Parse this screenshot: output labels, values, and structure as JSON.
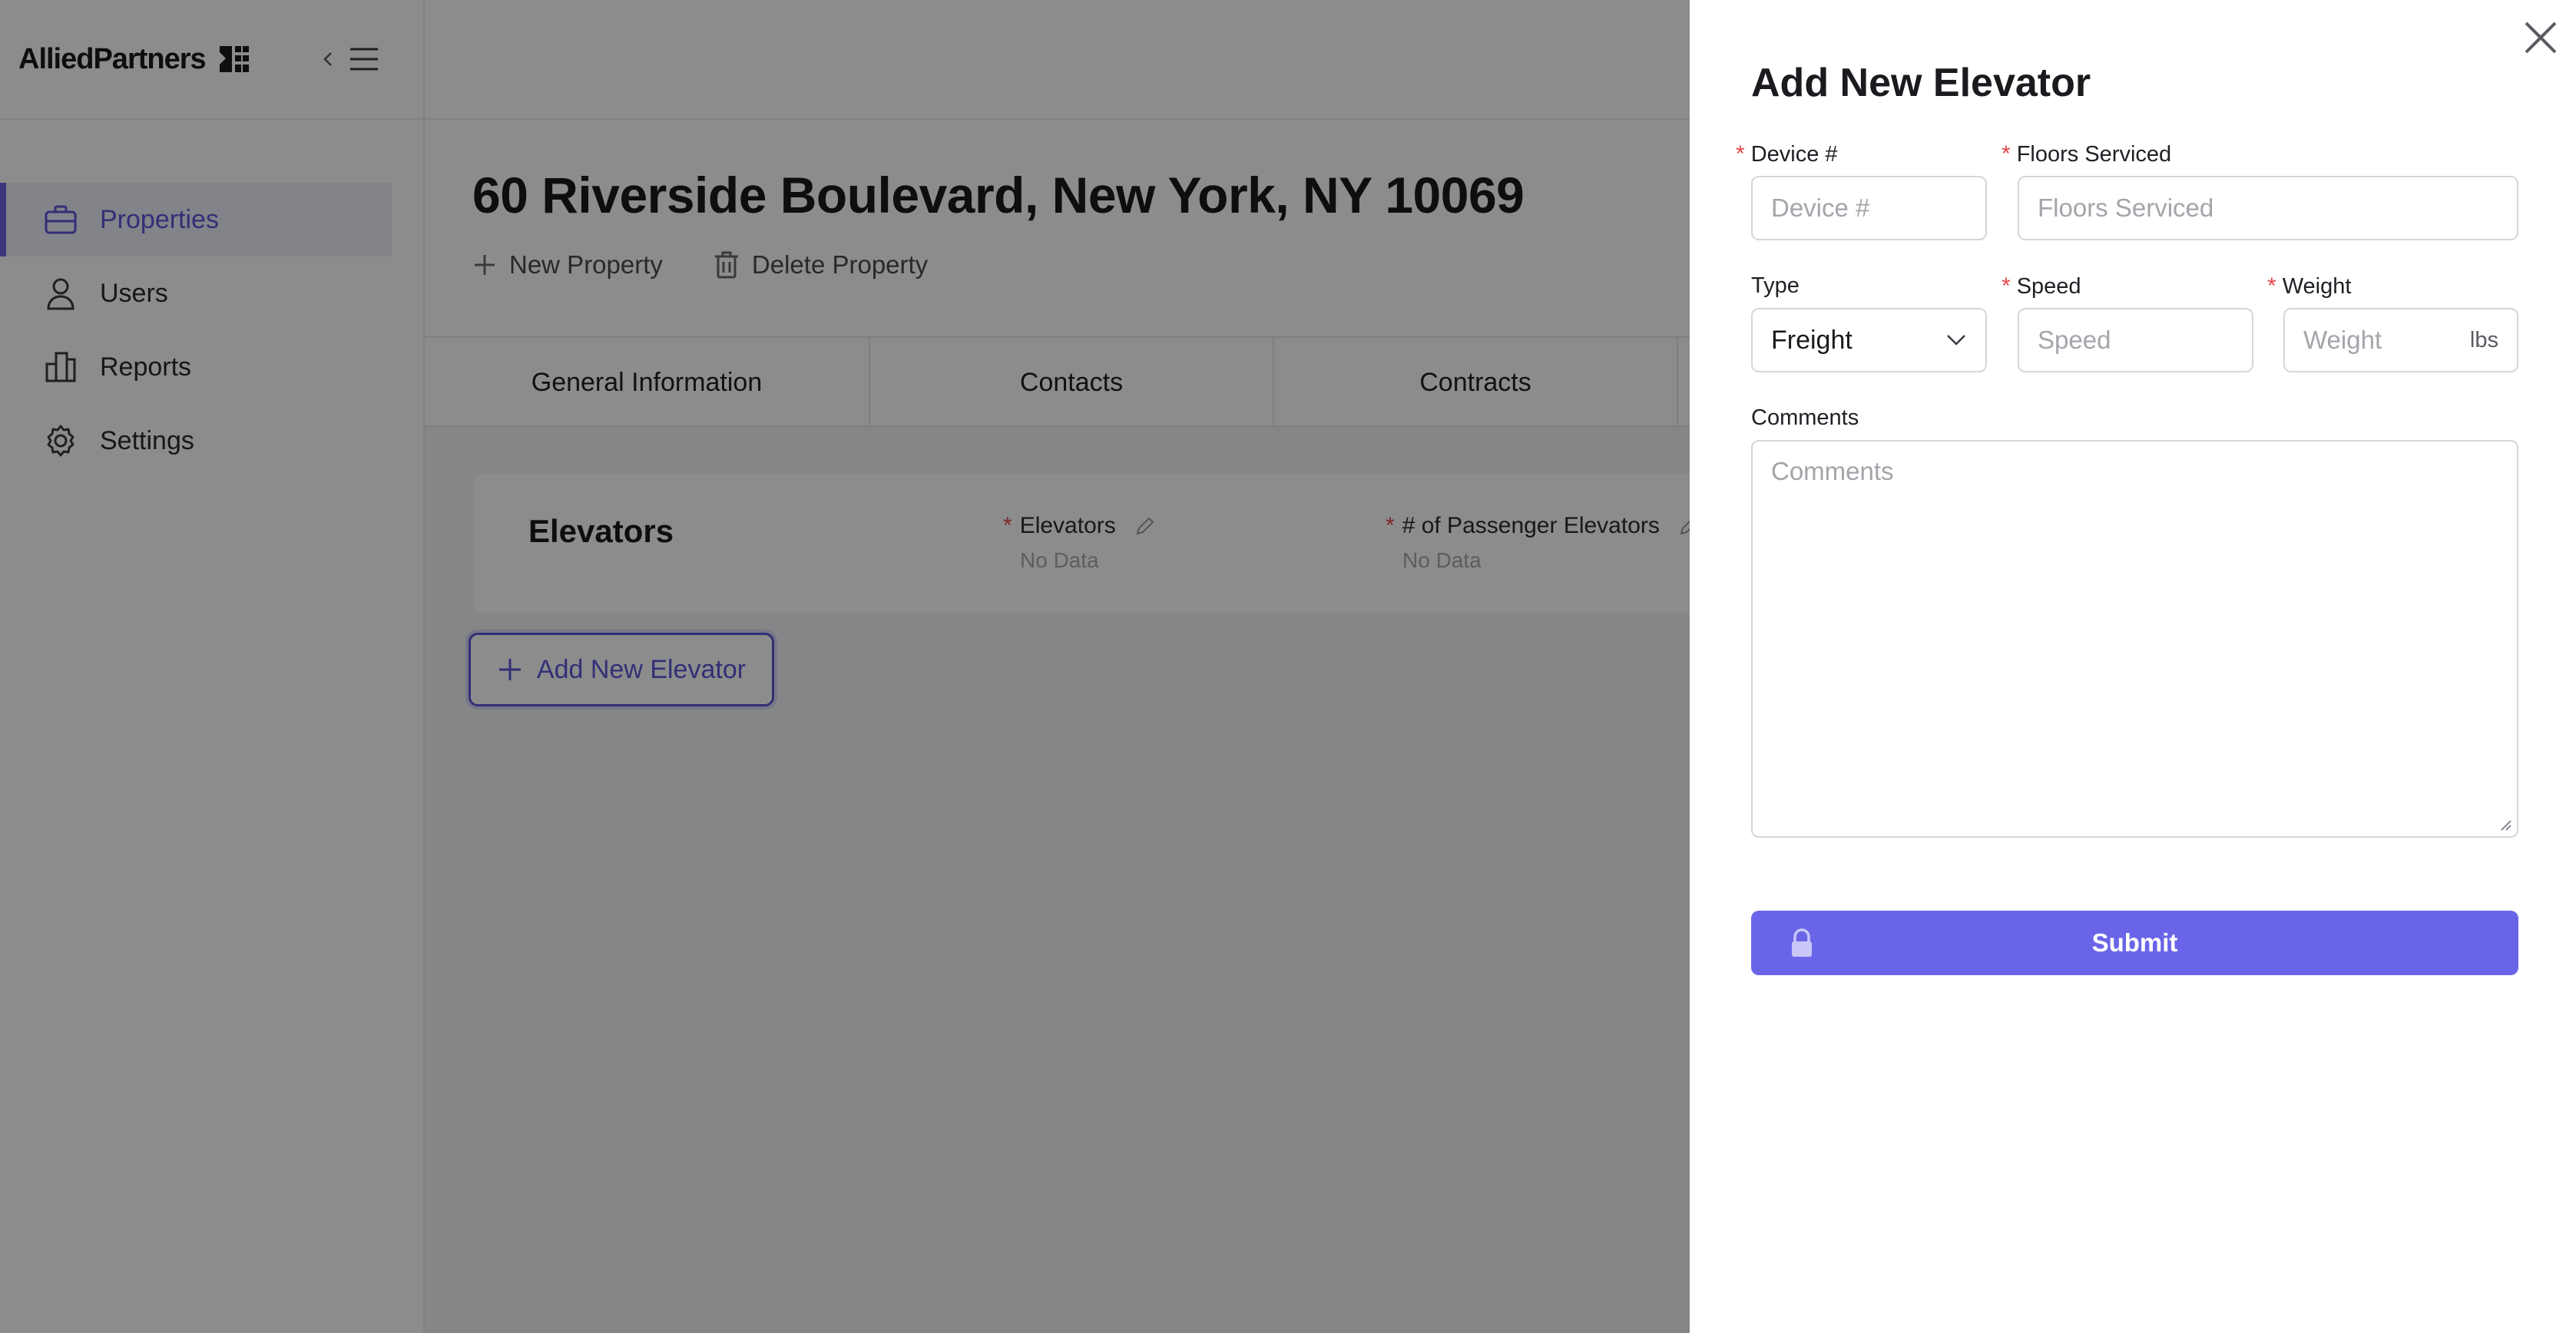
{
  "brand": {
    "name": "AlliedPartners"
  },
  "sidebar": {
    "items": [
      {
        "label": "Properties",
        "icon": "briefcase-icon",
        "active": true
      },
      {
        "label": "Users",
        "icon": "user-icon",
        "active": false
      },
      {
        "label": "Reports",
        "icon": "building-icon",
        "active": false
      },
      {
        "label": "Settings",
        "icon": "gear-icon",
        "active": false
      }
    ]
  },
  "header": {
    "title": "60 Riverside Boulevard, New York, NY 10069",
    "actions": {
      "new_property": "New Property",
      "delete_property": "Delete Property"
    }
  },
  "tabs": [
    "General Information",
    "Contacts",
    "Contracts",
    ""
  ],
  "elevators_card": {
    "title": "Elevators",
    "fields": [
      {
        "label": "Elevators",
        "value": "No Data"
      },
      {
        "label": "# of Passenger Elevators",
        "value": "No Data"
      }
    ]
  },
  "add_button": {
    "label": "Add New Elevator"
  },
  "drawer": {
    "title": "Add New Elevator",
    "device": {
      "label": "Device #",
      "placeholder": "Device #"
    },
    "floors": {
      "label": "Floors Serviced",
      "placeholder": "Floors Serviced"
    },
    "type": {
      "label": "Type",
      "value": "Freight"
    },
    "speed": {
      "label": "Speed",
      "placeholder": "Speed"
    },
    "weight": {
      "label": "Weight",
      "placeholder": "Weight",
      "unit": "lbs"
    },
    "comments": {
      "label": "Comments",
      "placeholder": "Comments"
    },
    "submit": "Submit"
  },
  "colors": {
    "accent": "#6a65e8",
    "required": "#e5484d",
    "overlay": "rgba(0,0,0,0.45)"
  }
}
